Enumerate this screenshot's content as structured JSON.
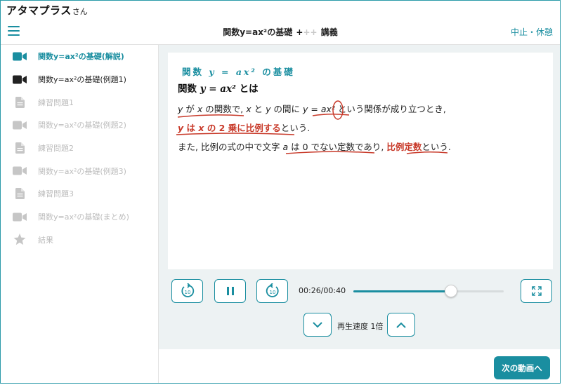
{
  "app": {
    "brand": "アタマプラス",
    "brand_suffix": "さん"
  },
  "header": {
    "title": "関数y=ax²の基礎",
    "plus_marks": "+",
    "plus_marks_dim": "++",
    "mode": "講義",
    "pause_link": "中止・休憩"
  },
  "sidebar": {
    "items": [
      {
        "label": "関数y=ax²の基礎(解説)",
        "icon": "video-camera-icon",
        "state": "active"
      },
      {
        "label": "関数y=ax²の基礎(例題1)",
        "icon": "video-camera-icon",
        "state": "done"
      },
      {
        "label": "練習問題1",
        "icon": "document-icon",
        "state": "locked"
      },
      {
        "label": "関数y=ax²の基礎(例題2)",
        "icon": "video-camera-icon",
        "state": "locked"
      },
      {
        "label": "練習問題2",
        "icon": "document-icon",
        "state": "locked"
      },
      {
        "label": "関数y=ax²の基礎(例題3)",
        "icon": "video-camera-icon",
        "state": "locked"
      },
      {
        "label": "練習問題3",
        "icon": "document-icon",
        "state": "locked"
      },
      {
        "label": "関数y=ax²の基礎(まとめ)",
        "icon": "video-camera-icon",
        "state": "locked"
      },
      {
        "label": "結果",
        "icon": "star-icon",
        "state": "locked"
      }
    ]
  },
  "lecture": {
    "heading": {
      "prefix": "関数",
      "formula": "y = ax²",
      "suffix": "の基礎"
    },
    "subheading": {
      "prefix": "関数",
      "formula": "y = ax²",
      "suffix": "とは"
    },
    "line1": {
      "y": "y",
      "ga": "が",
      "x": "x",
      "text_a": "の関数で,",
      "x2": "x",
      "to": "と",
      "y2": "y",
      "text_b": "の間に",
      "formula": "y = ax²",
      "text_c": "という関係が成り立つとき,"
    },
    "line2": {
      "highlight_y": "y",
      "highlight_a": "は",
      "highlight_x": "x",
      "highlight_b": "の 2 乗に比例する",
      "text": "という."
    },
    "line3": {
      "text_a": "また, 比例の式の中で文字",
      "a": "a",
      "text_b": "は",
      "zero": "0",
      "text_c": "でない定数であり,",
      "highlight": "比例定数",
      "text_d": "という."
    }
  },
  "player": {
    "current_time": "00:26",
    "total_time": "00:40",
    "progress": 0.65,
    "rewind_seconds": "10",
    "forward_seconds": "10",
    "speed_label": "再生速度 1倍"
  },
  "footer": {
    "next_button": "次の動画へ"
  },
  "colors": {
    "accent": "#1a8ea0",
    "ink_red": "#c83a2a",
    "panel": "#edf2f3"
  }
}
